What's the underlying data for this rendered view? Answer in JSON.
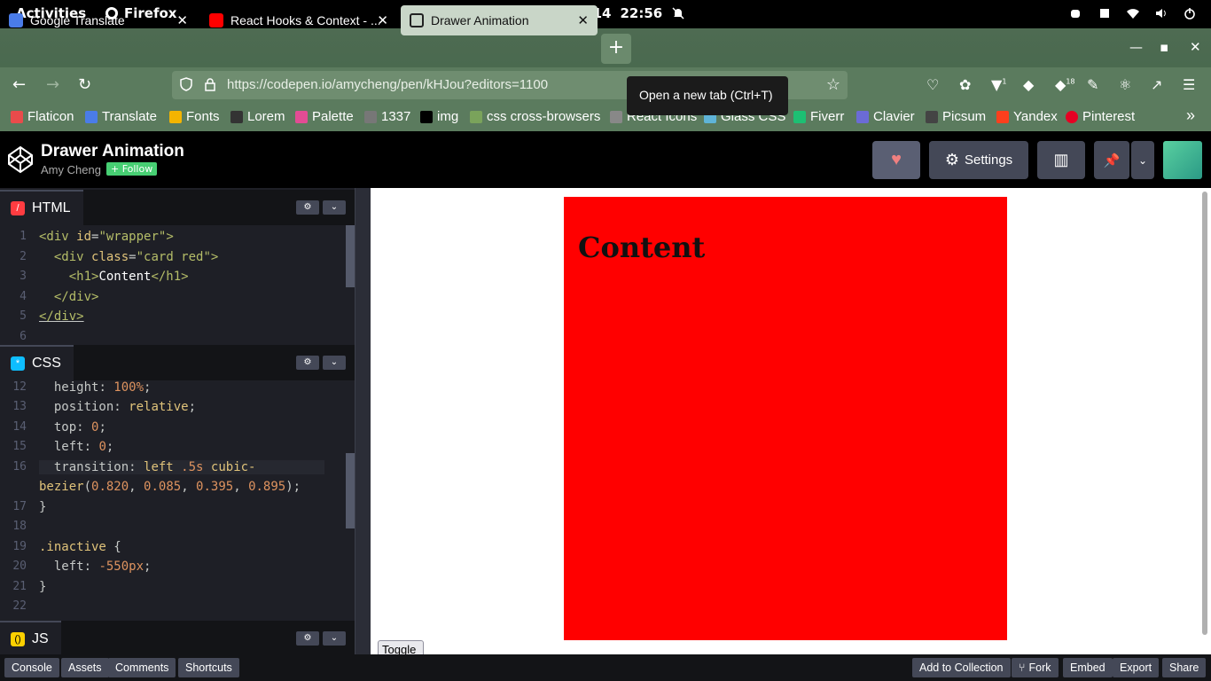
{
  "system": {
    "activities": "Activities",
    "app": "Firefox",
    "date": "Jan 14",
    "time": "22:56"
  },
  "tabs": [
    {
      "label": "Google Translate"
    },
    {
      "label": "React Hooks & Context - ..."
    },
    {
      "label": "Drawer Animation"
    }
  ],
  "navbar": {
    "url": "https://codepen.io/amycheng/pen/kHJou?editors=1100",
    "tooltip": "Open a new tab (Ctrl+T)",
    "ext_badge_1": "1",
    "ext_badge_18": "18"
  },
  "bookmarks": [
    {
      "label": "Flaticon",
      "color": "#e94b4b"
    },
    {
      "label": "Translate",
      "color": "#4a7ce8"
    },
    {
      "label": "Fonts",
      "color": "#f4b400"
    },
    {
      "label": "Lorem",
      "color": "#333333"
    },
    {
      "label": "Palette",
      "color": "#e24c94"
    },
    {
      "label": "1337",
      "color": "#777777"
    },
    {
      "label": "img",
      "color": "#000000"
    },
    {
      "label": "css cross-browsers",
      "color": "#7aa35b"
    },
    {
      "label": "React Icons",
      "color": "#888888"
    },
    {
      "label": "Glass CSS",
      "color": "#5fb4d8"
    },
    {
      "label": "Fiverr",
      "color": "#1dbf73"
    },
    {
      "label": "Clavier",
      "color": "#6b6bd6"
    },
    {
      "label": "Picsum",
      "color": "#444444"
    },
    {
      "label": "Yandex",
      "color": "#fc3f1d"
    },
    {
      "label": "Pinterest",
      "color": "#e60023"
    }
  ],
  "codepen": {
    "title": "Drawer Animation",
    "author": "Amy Cheng",
    "follow": "+ Follow",
    "settings": "Settings"
  },
  "html_pane": {
    "label": "HTML",
    "line_numbers": [
      "1",
      "2",
      "3",
      "4",
      "5",
      "6"
    ]
  },
  "css_pane": {
    "label": "CSS",
    "line_numbers": [
      "12",
      "13",
      "14",
      "15",
      "16",
      "",
      "17",
      "18",
      "19",
      "20",
      "21",
      "22"
    ]
  },
  "js_pane": {
    "label": "JS"
  },
  "preview": {
    "heading": "Content",
    "toggle": "Toggle",
    "card_color": "#ff0000"
  },
  "footer": {
    "console": "Console",
    "assets": "Assets",
    "comments": "Comments",
    "shortcuts": "Shortcuts",
    "add_to_collection": "Add to Collection",
    "fork": "Fork",
    "embed": "Embed",
    "export": "Export",
    "share": "Share"
  }
}
